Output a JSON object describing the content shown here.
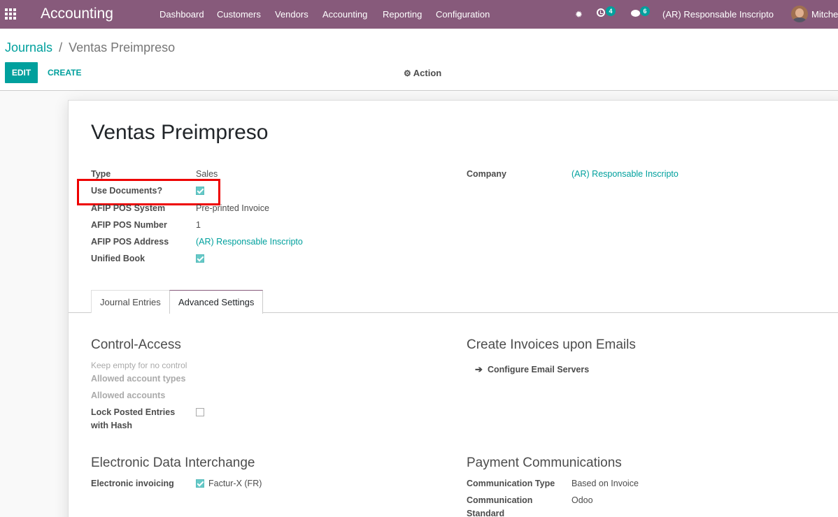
{
  "navbar": {
    "app_name": "Accounting",
    "menu": [
      "Dashboard",
      "Customers",
      "Vendors",
      "Accounting",
      "Reporting",
      "Configuration"
    ],
    "activity_count": "4",
    "message_count": "6",
    "company": "(AR) Responsable Inscripto",
    "user": "Mitche"
  },
  "breadcrumb": {
    "parent": "Journals",
    "separator": "/",
    "current": "Ventas Preimpreso"
  },
  "toolbar": {
    "edit_label": "EDIT",
    "create_label": "CREATE",
    "action_label": "Action"
  },
  "form": {
    "title": "Ventas Preimpreso",
    "fields": {
      "type_label": "Type",
      "type_value": "Sales",
      "use_documents_label": "Use Documents?",
      "use_documents_checked": true,
      "pos_system_label": "AFIP POS System",
      "pos_system_value": "Pre-printed Invoice",
      "pos_number_label": "AFIP POS Number",
      "pos_number_value": "1",
      "pos_address_label": "AFIP POS Address",
      "pos_address_value": "(AR) Responsable Inscripto",
      "unified_book_label": "Unified Book",
      "unified_book_checked": true,
      "company_label": "Company",
      "company_value": "(AR) Responsable Inscripto"
    },
    "tabs": [
      "Journal Entries",
      "Advanced Settings"
    ],
    "active_tab": "Advanced Settings",
    "control_access": {
      "title": "Control-Access",
      "hint": "Keep empty for no control",
      "allowed_types_label": "Allowed account types",
      "allowed_accounts_label": "Allowed accounts",
      "lock_posted_label_1": "Lock Posted Entries",
      "lock_posted_label_2": "with Hash",
      "lock_posted_checked": false
    },
    "emails": {
      "title": "Create Invoices upon Emails",
      "configure_label": "Configure Email Servers"
    },
    "edi": {
      "title": "Electronic Data Interchange",
      "einvoicing_label": "Electronic invoicing",
      "format_value": "Factur-X (FR)",
      "format_checked": true
    },
    "payment": {
      "title": "Payment Communications",
      "type_label": "Communication Type",
      "type_value": "Based on Invoice",
      "standard_label_1": "Communication",
      "standard_label_2": "Standard",
      "standard_value": "Odoo"
    }
  }
}
